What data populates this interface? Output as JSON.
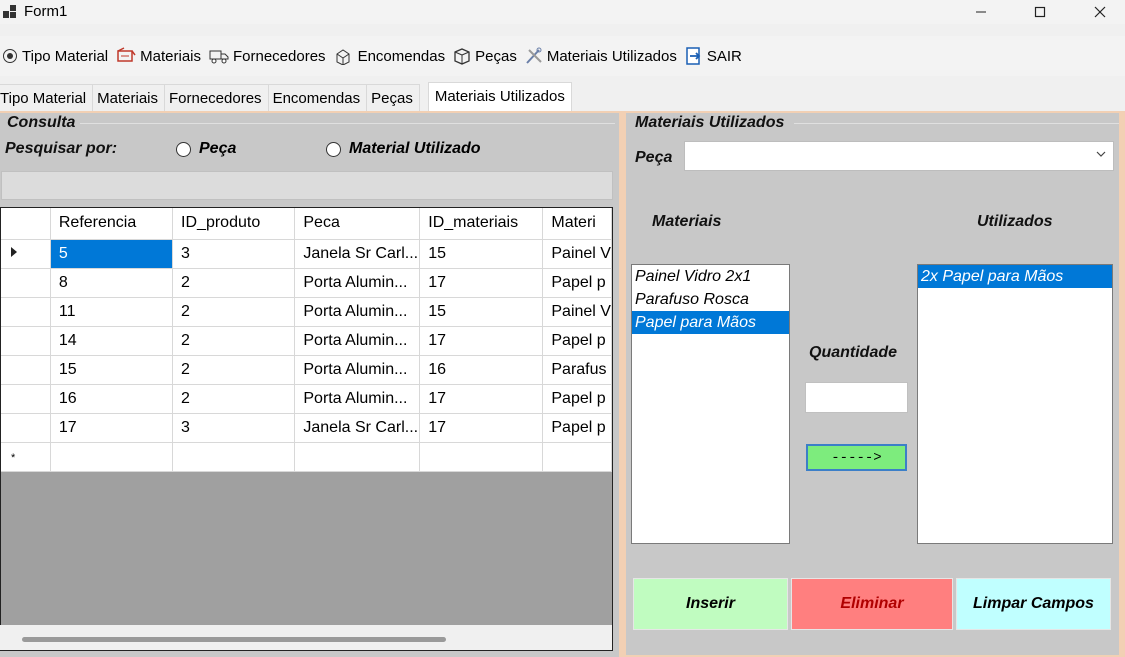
{
  "window": {
    "title": "Form1"
  },
  "menu": [
    {
      "label": "Tipo Material",
      "icon": "radio-icon"
    },
    {
      "label": "Materiais",
      "icon": "materials-icon"
    },
    {
      "label": "Fornecedores",
      "icon": "truck-icon"
    },
    {
      "label": "Encomendas",
      "icon": "boxes-icon"
    },
    {
      "label": "Peças",
      "icon": "box-icon"
    },
    {
      "label": "Materiais Utilizados",
      "icon": "tools-icon"
    },
    {
      "label": "SAIR",
      "icon": "exit-icon"
    }
  ],
  "tabs": [
    "Tipo Material",
    "Materiais",
    "Fornecedores",
    "Encomendas",
    "Peças",
    "Materiais Utilizados"
  ],
  "consulta": {
    "title": "Consulta",
    "search_by": "Pesquisar por:",
    "option_peca": "Peça",
    "option_material": "Material Utilizado",
    "search_value": ""
  },
  "grid": {
    "columns": [
      "Referencia",
      "ID_produto",
      "Peca",
      "ID_materiais",
      "Materi"
    ],
    "rows": [
      [
        "5",
        "3",
        "Janela Sr Carl...",
        "15",
        "Painel V"
      ],
      [
        "8",
        "2",
        "Porta Alumin...",
        "17",
        "Papel p"
      ],
      [
        "11",
        "2",
        "Porta Alumin...",
        "15",
        "Painel V"
      ],
      [
        "14",
        "2",
        "Porta Alumin...",
        "17",
        "Papel p"
      ],
      [
        "15",
        "2",
        "Porta Alumin...",
        "16",
        "Parafus"
      ],
      [
        "16",
        "2",
        "Porta Alumin...",
        "17",
        "Papel p"
      ],
      [
        "17",
        "3",
        "Janela Sr Carl...",
        "17",
        "Papel p"
      ]
    ],
    "current_row_marker": "▸",
    "new_row_marker": "*"
  },
  "materiais_utilizados": {
    "title": "Materiais Utilizados",
    "peca_label": "Peça",
    "peca_value": "",
    "materiais_label": "Materiais",
    "utilizados_label": "Utilizados",
    "materiais_list": [
      "Painel Vidro 2x1",
      "Parafuso Rosca",
      "Papel para Mãos"
    ],
    "materiais_selected": 2,
    "utilizados_list": [
      "2x Papel para Mãos"
    ],
    "utilizados_selected": 0,
    "quantidade_label": "Quantidade",
    "quantidade_value": "",
    "add_button": "----->",
    "inserir": "Inserir",
    "eliminar": "Eliminar",
    "limpar": "Limpar Campos"
  },
  "colors": {
    "inserir_bg": "#c0fcc0",
    "eliminar_bg": "#ff7f7f",
    "eliminar_text": "#b00000",
    "limpar_bg": "#c0ffff",
    "selection": "#0078d7",
    "arrow_btn_bg": "#7dec7d"
  }
}
